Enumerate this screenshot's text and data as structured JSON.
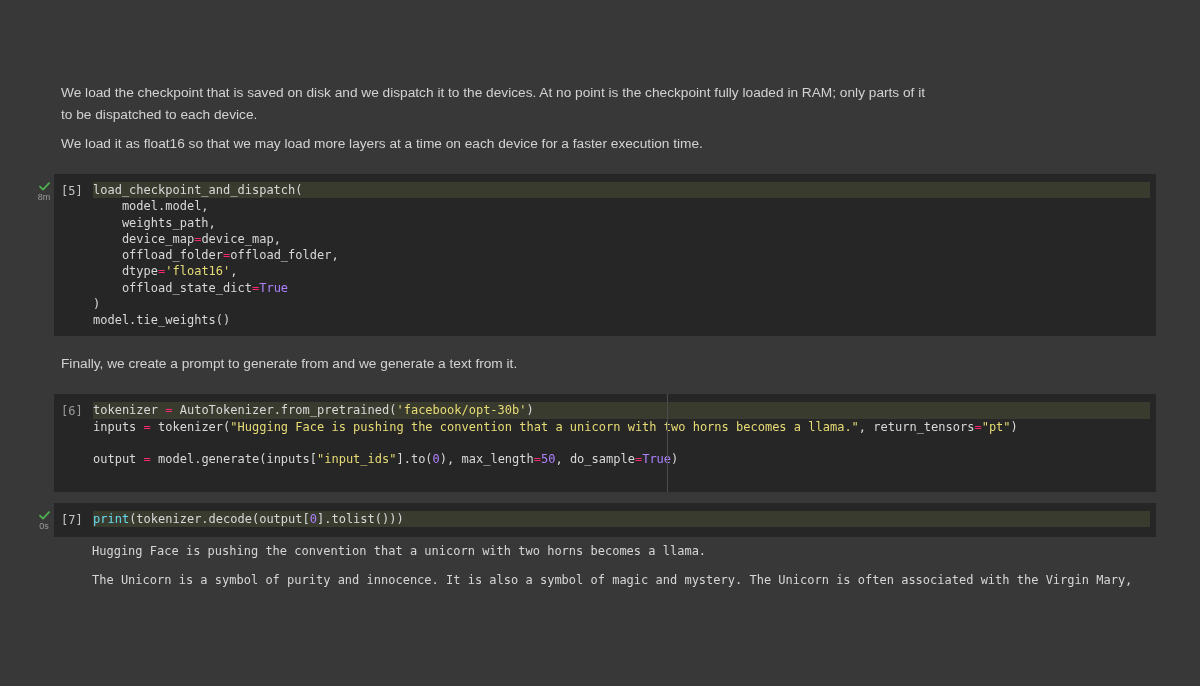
{
  "cells": [
    {
      "kind": "markdown",
      "paragraphs": [
        "We load the checkpoint that is saved on disk and we dispatch it to the devices. At no point is the checkpoint fully loaded in RAM; only parts of it to be dispatched to each device.",
        "We load it as float16 so that we may load more layers at a time on each device for a faster execution time."
      ]
    },
    {
      "kind": "code",
      "execution_count": "[5]",
      "succeeded": true,
      "duration": "8m",
      "lines": [
        {
          "highlighted": true,
          "tokens": [
            {
              "kind": "plain",
              "text": "load_checkpoint_and_dispatch("
            }
          ]
        },
        {
          "highlighted": false,
          "tokens": [
            {
              "kind": "plain",
              "text": "    model.model,"
            }
          ]
        },
        {
          "highlighted": false,
          "tokens": [
            {
              "kind": "plain",
              "text": "    weights_path,"
            }
          ]
        },
        {
          "highlighted": false,
          "tokens": [
            {
              "kind": "plain",
              "text": "    device_map"
            },
            {
              "kind": "operator",
              "text": "="
            },
            {
              "kind": "plain",
              "text": "device_map,"
            }
          ]
        },
        {
          "highlighted": false,
          "tokens": [
            {
              "kind": "plain",
              "text": "    offload_folder"
            },
            {
              "kind": "operator",
              "text": "="
            },
            {
              "kind": "plain",
              "text": "offload_folder,"
            }
          ]
        },
        {
          "highlighted": false,
          "tokens": [
            {
              "kind": "plain",
              "text": "    dtype"
            },
            {
              "kind": "operator",
              "text": "="
            },
            {
              "kind": "string",
              "text": "'float16'"
            },
            {
              "kind": "plain",
              "text": ","
            }
          ]
        },
        {
          "highlighted": false,
          "tokens": [
            {
              "kind": "plain",
              "text": "    offload_state_dict"
            },
            {
              "kind": "operator",
              "text": "="
            },
            {
              "kind": "keyword",
              "text": "True"
            }
          ]
        },
        {
          "highlighted": false,
          "tokens": [
            {
              "kind": "plain",
              "text": ")"
            }
          ]
        },
        {
          "highlighted": false,
          "tokens": [
            {
              "kind": "plain",
              "text": "model.tie_weights()"
            }
          ]
        }
      ]
    },
    {
      "kind": "markdown",
      "paragraphs": [
        "Finally, we create a prompt to generate from and we generate a text from it."
      ]
    },
    {
      "kind": "code",
      "execution_count": "[6]",
      "succeeded": false,
      "ruler": true,
      "lines": [
        {
          "highlighted": true,
          "tokens": [
            {
              "kind": "plain",
              "text": "tokenizer "
            },
            {
              "kind": "operator",
              "text": "="
            },
            {
              "kind": "plain",
              "text": " AutoTokenizer.from_pretrained("
            },
            {
              "kind": "string",
              "text": "'facebook/opt-30b'"
            },
            {
              "kind": "plain",
              "text": ")"
            }
          ]
        },
        {
          "highlighted": false,
          "tokens": [
            {
              "kind": "plain",
              "text": "inputs "
            },
            {
              "kind": "operator",
              "text": "="
            },
            {
              "kind": "plain",
              "text": " tokenizer("
            },
            {
              "kind": "string",
              "text": "\"Hugging Face is pushing the convention that a unicorn with two horns becomes a llama.\""
            },
            {
              "kind": "plain",
              "text": ", return_tensors"
            },
            {
              "kind": "operator",
              "text": "="
            },
            {
              "kind": "string",
              "text": "\"pt\""
            },
            {
              "kind": "plain",
              "text": ")"
            }
          ]
        },
        {
          "highlighted": false
        },
        {
          "highlighted": false,
          "tokens": [
            {
              "kind": "plain",
              "text": "output "
            },
            {
              "kind": "operator",
              "text": "="
            },
            {
              "kind": "plain",
              "text": " model.generate(inputs["
            },
            {
              "kind": "string",
              "text": "\"input_ids\""
            },
            {
              "kind": "plain",
              "text": "].to("
            },
            {
              "kind": "number",
              "text": "0"
            },
            {
              "kind": "plain",
              "text": "), max_length"
            },
            {
              "kind": "operator",
              "text": "="
            },
            {
              "kind": "number",
              "text": "50"
            },
            {
              "kind": "plain",
              "text": ", do_sample"
            },
            {
              "kind": "operator",
              "text": "="
            },
            {
              "kind": "keyword",
              "text": "True"
            },
            {
              "kind": "plain",
              "text": ")"
            }
          ]
        },
        {
          "highlighted": false
        }
      ]
    },
    {
      "kind": "code",
      "execution_count": "[7]",
      "succeeded": true,
      "duration": "0s",
      "lines": [
        {
          "highlighted": true,
          "tokens": [
            {
              "kind": "builtin",
              "text": "print"
            },
            {
              "kind": "plain",
              "text": "(tokenizer.decode(output["
            },
            {
              "kind": "number",
              "text": "0"
            },
            {
              "kind": "plain",
              "text": "].tolist()))"
            }
          ]
        }
      ],
      "output": [
        "Hugging Face is pushing the convention that a unicorn with two horns becomes a llama.",
        "The Unicorn is a symbol of purity and innocence. It is also a symbol of magic and mystery. The Unicorn is often associated with the Virgin Mary,"
      ]
    }
  ]
}
